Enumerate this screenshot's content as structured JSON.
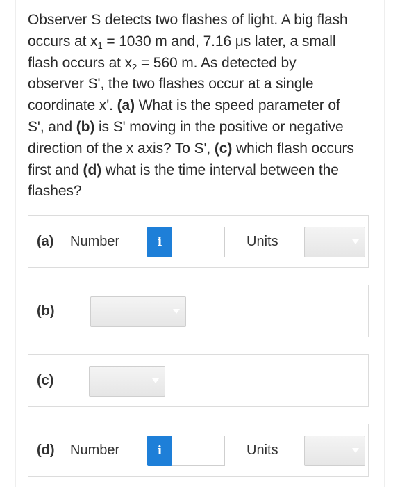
{
  "question": {
    "l1": "Observer S detects two flashes of light. A big flash",
    "l2_pre": "occurs at x",
    "l2_sub": "1",
    "l2_post": " = 1030 m and, 7.16 μs later, a small",
    "l3_pre": "flash occurs at x",
    "l3_sub": "2",
    "l3_post": " = 560 m. As detected by",
    "l4": "observer S', the two flashes occur at a single",
    "l5_pre": "coordinate x'. ",
    "l5_a": "(a)",
    "l5_post": " What is the speed parameter of",
    "l6_pre": "S', and ",
    "l6_b": "(b)",
    "l6_post": " is S' moving in the positive or negative",
    "l7_pre": "direction of the x axis? To S', ",
    "l7_c": "(c)",
    "l7_post": " which flash occurs",
    "l8_pre": "first and ",
    "l8_d": "(d)",
    "l8_post": " what is the time interval between the",
    "l9": "flashes?"
  },
  "parts": {
    "a": {
      "label": "(a)",
      "number_label": "Number",
      "info": "i",
      "value": "",
      "units_label": "Units",
      "units_selected": ""
    },
    "b": {
      "label": "(b)",
      "selected": ""
    },
    "c": {
      "label": "(c)",
      "selected": ""
    },
    "d": {
      "label": "(d)",
      "number_label": "Number",
      "info": "i",
      "value": "",
      "units_label": "Units",
      "units_selected": ""
    }
  },
  "colors": {
    "info_button": "#1e7fd8",
    "border": "#dcdcdc"
  },
  "icons": {
    "info": "info-icon",
    "dropdown": "chevron-down-icon"
  }
}
